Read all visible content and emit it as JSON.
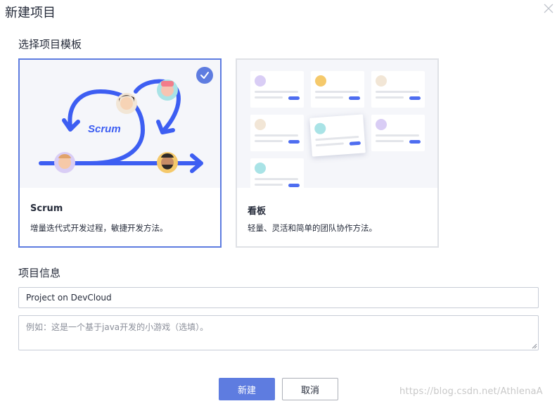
{
  "dialog": {
    "title": "新建项目"
  },
  "template_section": {
    "label": "选择项目模板",
    "cards": [
      {
        "name": "Scrum",
        "description": "增量迭代式开发过程，敏捷开发方法。",
        "illustration_text": "Scrum",
        "selected": true
      },
      {
        "name": "看板",
        "description": "轻量、灵活和简单的团队协作方法。",
        "selected": false
      }
    ]
  },
  "info_section": {
    "label": "项目信息",
    "name_value": "Project on DevCloud",
    "description_placeholder": "例如：这是一个基于java开发的小游戏（选填）。"
  },
  "footer": {
    "create_label": "新建",
    "cancel_label": "取消"
  },
  "watermark": "https://blog.csdn.net/AthlenaA",
  "colors": {
    "accent": "#5e7ce0",
    "illustration_blue": "#3d5ef2",
    "illustration_bg": "#f5f6fa"
  },
  "icons": [
    "close-icon",
    "check-icon",
    "resize-grip-icon"
  ]
}
